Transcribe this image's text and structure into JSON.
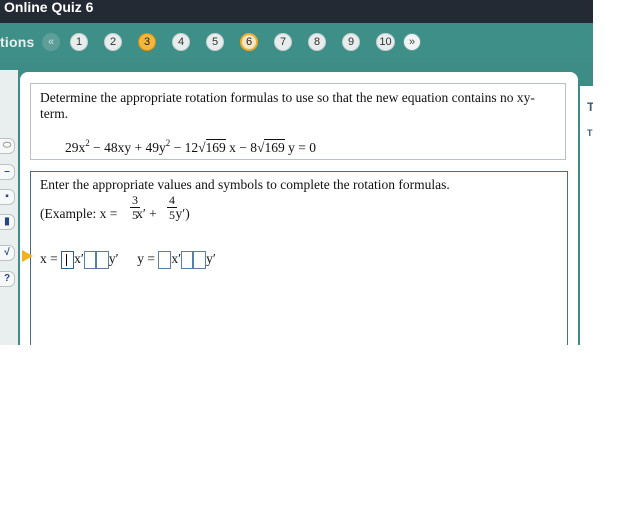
{
  "window": {
    "title": "Online Quiz 6"
  },
  "nav": {
    "label": "tions",
    "prev_icon": "«",
    "next_icon": "»",
    "questions": [
      "1",
      "2",
      "3",
      "4",
      "5",
      "6",
      "7",
      "8",
      "9",
      "10"
    ],
    "current": "6",
    "highlighted": "3"
  },
  "tools": [
    "⬭",
    "–",
    "▪",
    "▮",
    "√",
    "?"
  ],
  "right_panel": {
    "t1": "T",
    "t2": "T"
  },
  "question": {
    "prompt": "Determine the appropriate rotation formulas to use so that the new equation contains no xy-term.",
    "equation": {
      "p1": "29x",
      "e1": "2",
      "p2": " − 48xy + 49y",
      "e2": "2",
      "p3": " − 12",
      "r1": "√",
      "rad1": "169",
      "p4": " x − 8",
      "r2": "√",
      "rad2": "169",
      "p5": " y = 0"
    }
  },
  "answer": {
    "instruction": "Enter the appropriate values and symbols to complete the rotation formulas.",
    "example": {
      "open": "(Example:  x =",
      "frac1_num": "3",
      "frac1_den": "5",
      "mid": "x′ +",
      "frac2_num": "4",
      "frac2_den": "5",
      "close": "y′)"
    },
    "formula": {
      "x_label": "x =",
      "xprime": "x′",
      "yprime": "y′",
      "y_label": "y =",
      "xprime2": "x′",
      "yprime2": "y′"
    }
  },
  "colors": {
    "accent": "#f5b73a",
    "teal": "#3f8f89",
    "dark": "#242a33"
  }
}
